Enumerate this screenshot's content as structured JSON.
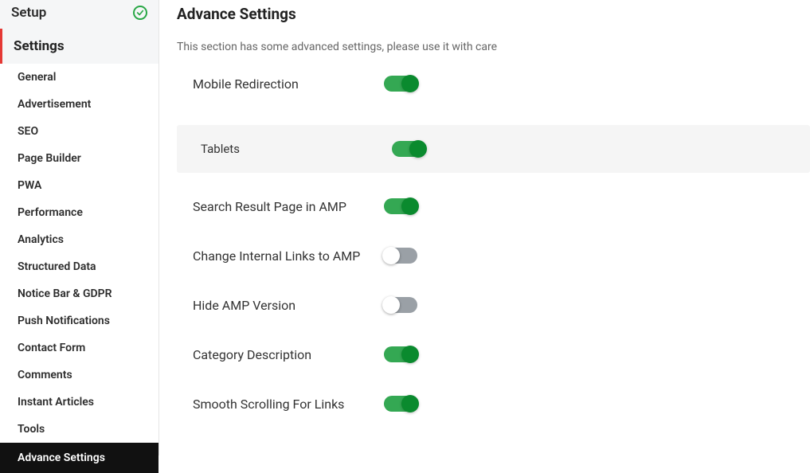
{
  "sidebar": {
    "setup_label": "Setup",
    "settings_label": "Settings",
    "items": [
      {
        "label": "General"
      },
      {
        "label": "Advertisement"
      },
      {
        "label": "SEO"
      },
      {
        "label": "Page Builder"
      },
      {
        "label": "PWA"
      },
      {
        "label": "Performance"
      },
      {
        "label": "Analytics"
      },
      {
        "label": "Structured Data"
      },
      {
        "label": "Notice Bar & GDPR"
      },
      {
        "label": "Push Notifications"
      },
      {
        "label": "Contact Form"
      },
      {
        "label": "Comments"
      },
      {
        "label": "Instant Articles"
      },
      {
        "label": "Tools"
      },
      {
        "label": "Advance Settings"
      }
    ],
    "active_index": 14
  },
  "main": {
    "title": "Advance Settings",
    "description": "This section has some advanced settings, please use it with care",
    "options": [
      {
        "label": "Mobile Redirection",
        "value": true,
        "nested": false
      },
      {
        "label": "Tablets",
        "value": true,
        "nested": true
      },
      {
        "label": "Search Result Page in AMP",
        "value": true,
        "nested": false
      },
      {
        "label": "Change Internal Links to AMP",
        "value": false,
        "nested": false
      },
      {
        "label": "Hide AMP Version",
        "value": false,
        "nested": false
      },
      {
        "label": "Category Description",
        "value": true,
        "nested": false
      },
      {
        "label": "Smooth Scrolling For Links",
        "value": true,
        "nested": false
      }
    ]
  }
}
